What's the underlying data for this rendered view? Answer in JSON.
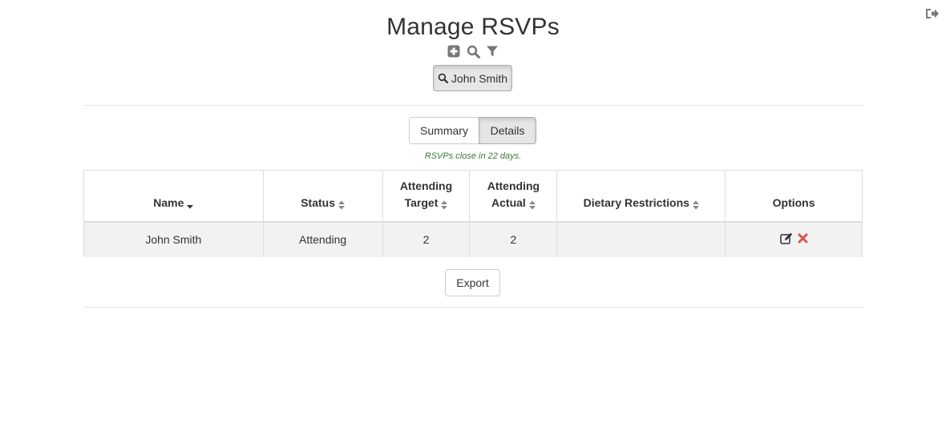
{
  "page": {
    "title": "Manage RSVPs",
    "header_icons": [
      "plus-square-icon",
      "search-icon",
      "filter-icon"
    ],
    "logout_icon": "sign-out-icon"
  },
  "search_chip": {
    "icon": "search-icon",
    "label": "John Smith"
  },
  "tabs": [
    {
      "label": "Summary",
      "active": false
    },
    {
      "label": "Details",
      "active": true
    }
  ],
  "notice": "RSVPs close in 22 days.",
  "table": {
    "columns": [
      {
        "label": "Name",
        "sort": "desc"
      },
      {
        "label_line1": "Status",
        "sort": "both"
      },
      {
        "label_line1": "Attending",
        "label_line2": "Target",
        "sort": "both"
      },
      {
        "label_line1": "Attending",
        "label_line2": "Actual",
        "sort": "both"
      },
      {
        "label_line1": "Dietary Restrictions",
        "sort": "both"
      },
      {
        "label_line1": "Options",
        "sort": "none"
      }
    ],
    "rows": [
      {
        "name": "John Smith",
        "status": "Attending",
        "attending_target": "2",
        "attending_actual": "2",
        "dietary_restrictions": "",
        "options": [
          "edit-icon",
          "delete-icon"
        ]
      }
    ]
  },
  "export_label": "Export",
  "colors": {
    "status_attending": "#5cb85c",
    "notice": "#3c763d",
    "delete": "#d9534f"
  }
}
